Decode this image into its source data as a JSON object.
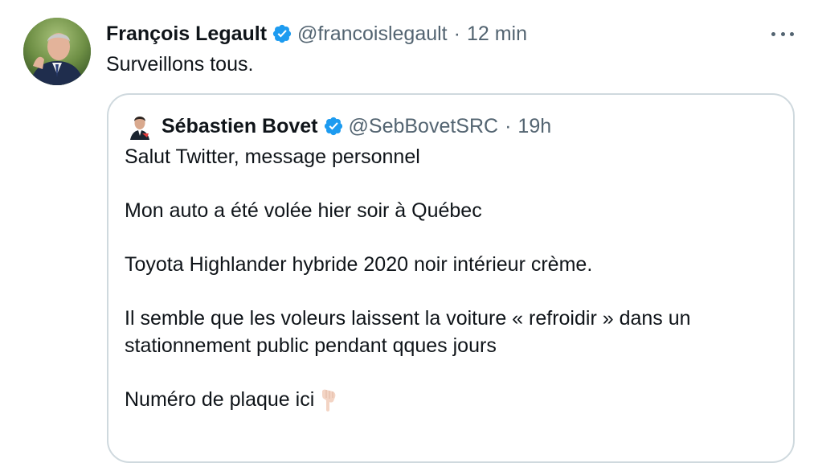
{
  "tweet": {
    "author_name": "François Legault",
    "author_handle": "@francoislegault",
    "separator": "·",
    "time": "12 min",
    "text": "Surveillons tous.",
    "verified_icon": "verified-badge-icon",
    "more_icon": "more-options-icon"
  },
  "quote": {
    "author_name": "Sébastien Bovet",
    "author_handle": "@SebBovetSRC",
    "separator": "·",
    "time": "19h",
    "paragraphs": [
      "Salut Twitter, message personnel",
      "Mon auto a été volée hier soir à Québec",
      "Toyota Highlander hybride 2020 noir intérieur crème.",
      "Il semble que les voleurs laissent la voiture « refroidir » dans un stationnement public pendant qques jours",
      "Numéro de plaque ici"
    ],
    "emoji": "pointing-down-hand-icon"
  },
  "colors": {
    "text": "#0f1419",
    "secondary": "#536471",
    "verified": "#1d9bf0",
    "border": "#cfd9de"
  }
}
